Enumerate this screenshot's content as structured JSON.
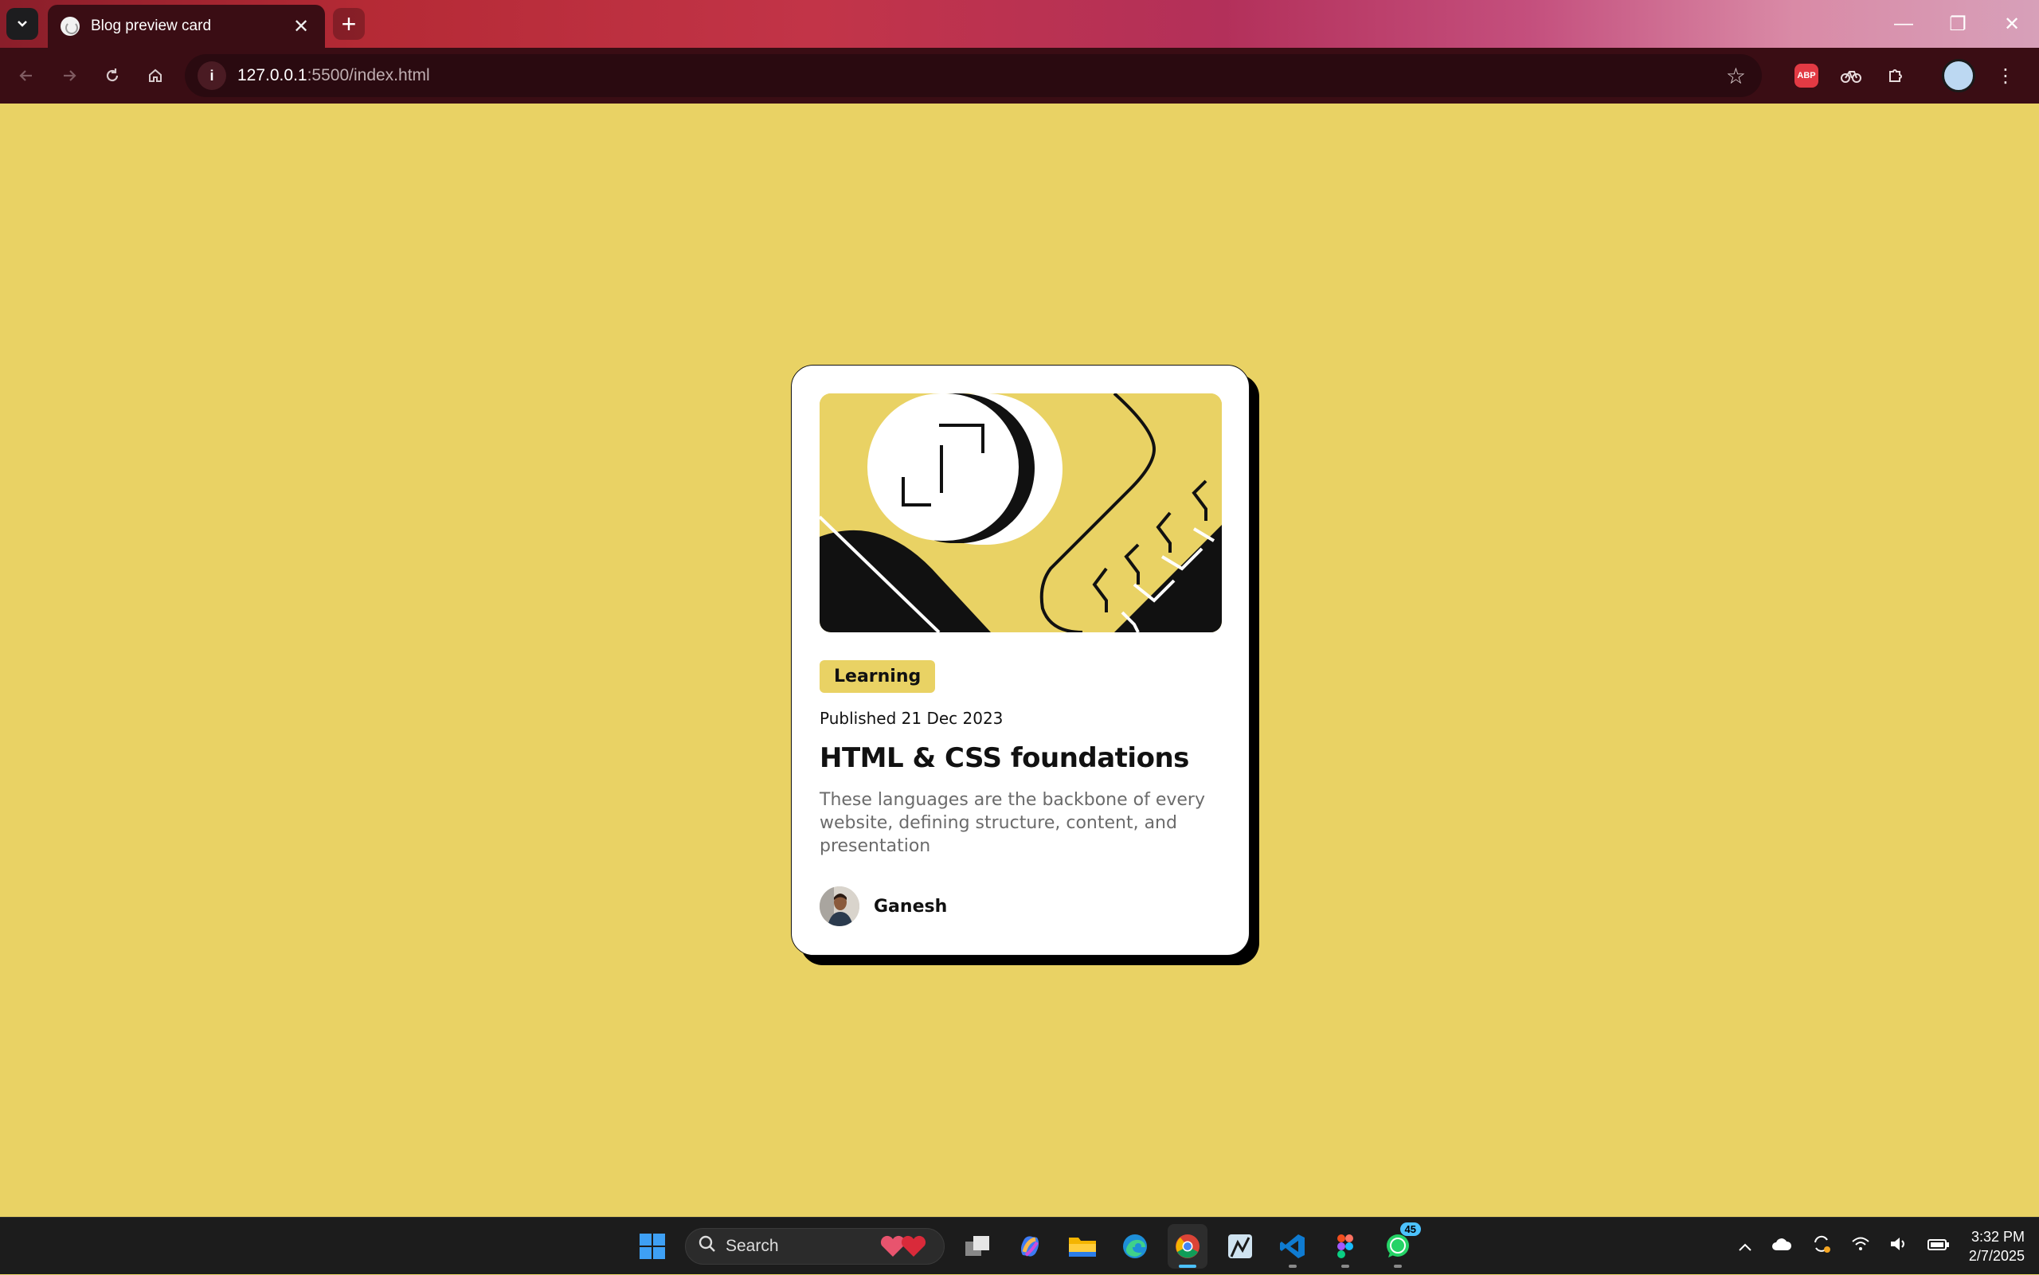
{
  "browser": {
    "tab_title": "Blog preview card",
    "tab_close": "✕",
    "new_tab": "+",
    "url_host": "127.0.0.1",
    "url_path": ":5500/index.html",
    "site_info": "i",
    "extensions": {
      "abp_label": "ABP"
    },
    "window_controls": {
      "minimize": "—",
      "restore": "❐",
      "close": "✕"
    }
  },
  "card": {
    "tag": "Learning",
    "published": "Published 21 Dec 2023",
    "title": "HTML & CSS foundations",
    "description": "These languages are the backbone of every website, defining structure, content, and presentation",
    "author": "Ganesh"
  },
  "taskbar": {
    "search_label": "Search",
    "whatsapp_badge": "45",
    "time": "3:32 PM",
    "date": "2/7/2025"
  },
  "colors": {
    "page_background": "#e9d264",
    "card_background": "#ffffff",
    "tag_background": "#e9d264",
    "description_text": "#6b6b6b",
    "taskbar_accent": "#4cc2ff"
  }
}
